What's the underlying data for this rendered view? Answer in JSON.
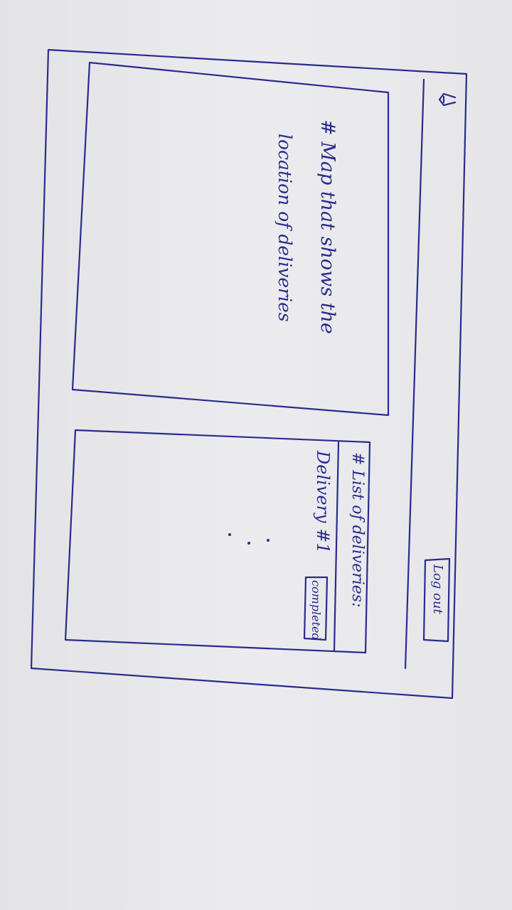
{
  "header": {
    "home_icon": "home-icon",
    "logout_label": "Log out"
  },
  "map_panel": {
    "caption_line1": "# Map that shows the",
    "caption_line2": "location of deliveries"
  },
  "deliveries_panel": {
    "title": "# List of deliveries:",
    "items": [
      {
        "label": "Delivery #1",
        "action_label": "completed"
      }
    ],
    "more_indicator": "⋮"
  },
  "colors": {
    "ink": "#2b2a8f",
    "paper": "#e6e6e9"
  }
}
